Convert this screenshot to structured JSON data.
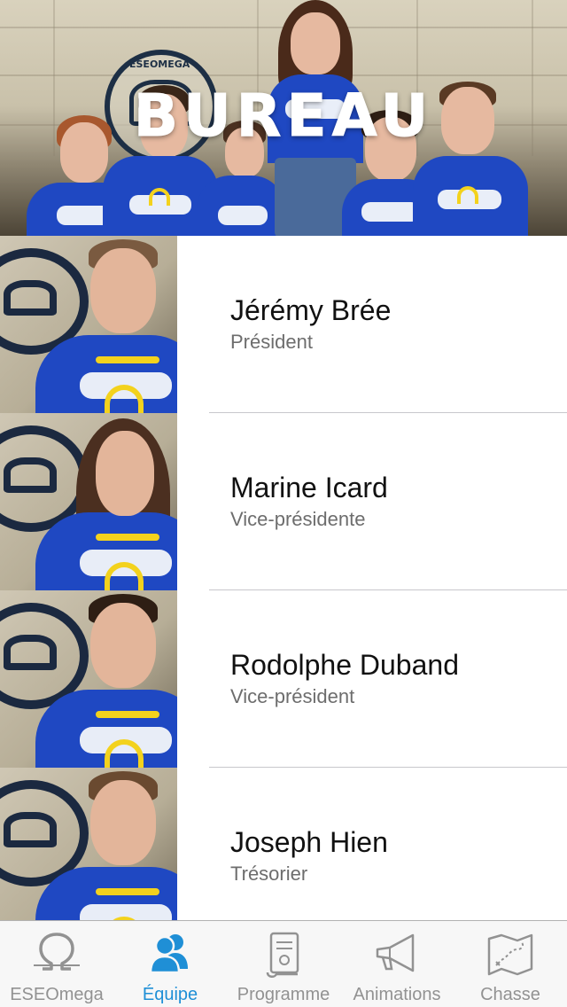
{
  "header": {
    "title": "BUREAU",
    "banner_text": "ESEOMEGA"
  },
  "members": [
    {
      "name": "Jérémy Brée",
      "role": "Président"
    },
    {
      "name": "Marine Icard",
      "role": "Vice-présidente"
    },
    {
      "name": "Rodolphe Duband",
      "role": "Vice-président"
    },
    {
      "name": "Joseph Hien",
      "role": "Trésorier"
    }
  ],
  "tabs": [
    {
      "label": "ESEOmega",
      "icon": "omega-icon",
      "active": false
    },
    {
      "label": "Équipe",
      "icon": "team-icon",
      "active": true
    },
    {
      "label": "Programme",
      "icon": "scroll-icon",
      "active": false
    },
    {
      "label": "Animations",
      "icon": "megaphone-icon",
      "active": false
    },
    {
      "label": "Chasse",
      "icon": "treasure-map-icon",
      "active": false
    }
  ],
  "colors": {
    "accent": "#1f8fd6",
    "inactive": "#929292",
    "shirt_blue": "#1f48c2",
    "separator": "#c8c7cc"
  }
}
